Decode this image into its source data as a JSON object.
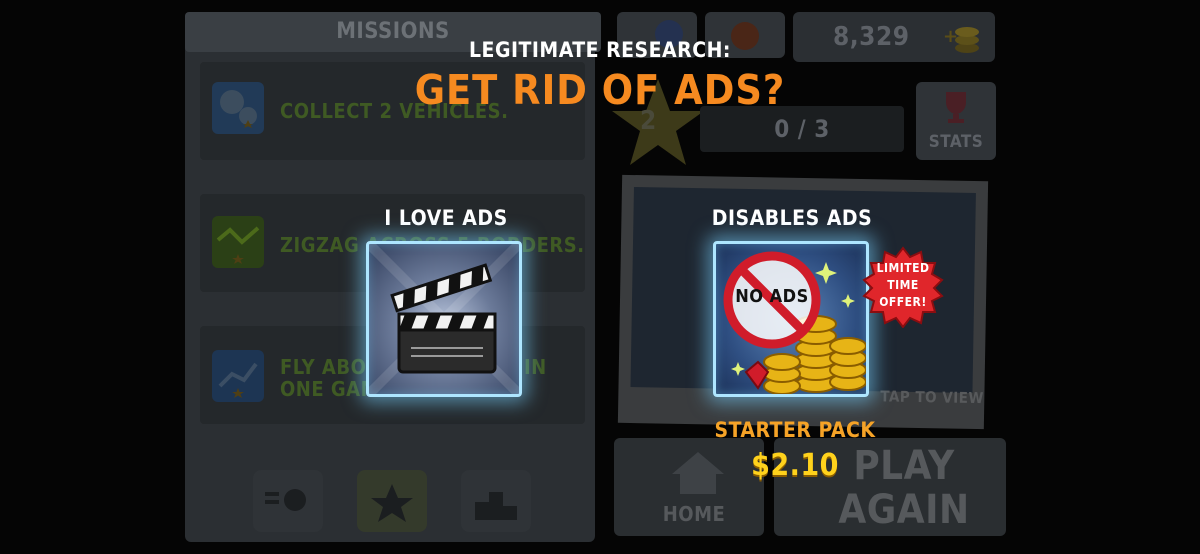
{
  "background": {
    "missions": {
      "header": "MISSIONS",
      "items": [
        {
          "label": "COLLECT 2 VEHICLES."
        },
        {
          "label": "ZIGZAG ACROSS 5 BORDERS."
        },
        {
          "label": "FLY ABOVE 30 METERS IN ONE GAME."
        }
      ],
      "tabs": [
        "list",
        "badge",
        "podium"
      ]
    },
    "coins": "8,329",
    "stage_number": "2",
    "progress": "0 / 3",
    "stats_label": "STATS",
    "tap_to_view": "TAP TO VIEW",
    "home_label": "HOME",
    "play_again_label": "PLAY AGAIN"
  },
  "overlay": {
    "research_label": "LEGITIMATE RESEARCH:",
    "title": "GET RID OF ADS?",
    "options": [
      {
        "label": "I LOVE ADS",
        "icon": "clapperboard-icon"
      },
      {
        "label": "DISABLES ADS",
        "icon": "no-ads-icon",
        "icon_text": "NO ADS"
      }
    ],
    "badge": [
      "LIMITED",
      "TIME",
      "OFFER!"
    ],
    "pack_title": "STARTER PACK",
    "price": "$2.10"
  },
  "colors": {
    "title": "#f68a20",
    "price": "#ffd21c",
    "card_glow": "#aee6ff",
    "badge": "#e0262b"
  }
}
